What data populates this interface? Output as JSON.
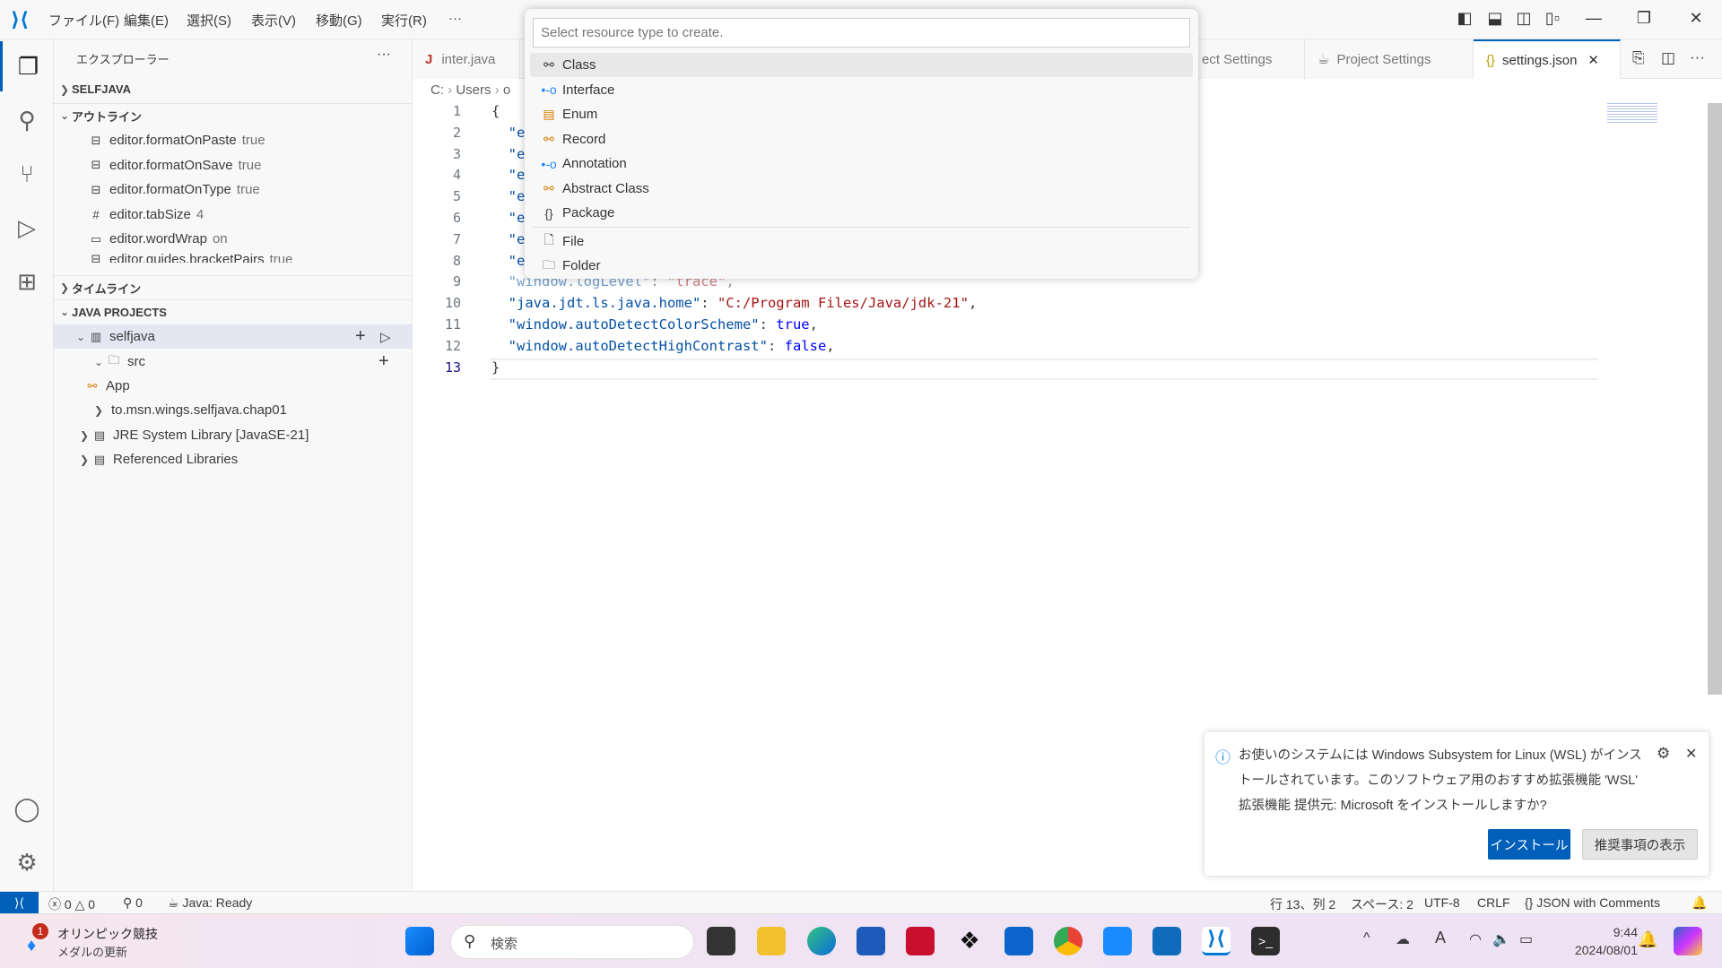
{
  "titlebar": {
    "menus": [
      "ファイル(F)",
      "編集(E)",
      "選択(S)",
      "表示(V)",
      "移動(G)",
      "実行(R)",
      "···"
    ],
    "window_controls": [
      "minimize",
      "restore",
      "close"
    ]
  },
  "activity_bar": {
    "items": [
      "explorer-icon",
      "search-icon",
      "source-control-icon",
      "run-debug-icon",
      "extensions-icon"
    ],
    "bottom": [
      "account-icon",
      "gear-icon"
    ]
  },
  "sidebar": {
    "title": "エクスプローラー",
    "more": "···",
    "selfjava": "SELFJAVA",
    "outline": {
      "title": "アウトライン",
      "items": [
        {
          "label": "editor.formatOnPaste",
          "value": "true"
        },
        {
          "label": "editor.formatOnSave",
          "value": "true"
        },
        {
          "label": "editor.formatOnType",
          "value": "true"
        },
        {
          "label": "editor.tabSize",
          "value": "4"
        },
        {
          "label": "editor.wordWrap",
          "value": "on"
        },
        {
          "label": "editor.guides.bracketPairs",
          "value": "true"
        }
      ]
    },
    "timeline": "タイムライン",
    "java_projects": {
      "title": "JAVA PROJECTS",
      "items": [
        "selfjava",
        "src",
        "App",
        "to.msn.wings.selfjava.chap01",
        "JRE System Library [JavaSE-21]",
        "Referenced Libraries"
      ]
    }
  },
  "tabs": [
    {
      "label": "inter.java"
    },
    {
      "label": "ect Settings"
    },
    {
      "label": "Project Settings"
    },
    {
      "label": "settings.json",
      "active": true
    }
  ],
  "breadcrumb": [
    "C:",
    "Users",
    "o"
  ],
  "editor": {
    "line_numbers": [
      "1",
      "2",
      "3",
      "4",
      "5",
      "6",
      "7",
      "8",
      "9",
      "10",
      "11",
      "12",
      "13"
    ],
    "lines": [
      [
        {
          "t": "{",
          "c": "p"
        }
      ],
      [
        {
          "t": "  \"e",
          "c": "k"
        }
      ],
      [
        {
          "t": "  \"e",
          "c": "k"
        }
      ],
      [
        {
          "t": "  \"e",
          "c": "k"
        }
      ],
      [
        {
          "t": "  \"e",
          "c": "k"
        }
      ],
      [
        {
          "t": "  \"e",
          "c": "k"
        }
      ],
      [
        {
          "t": "  \"e",
          "c": "k"
        }
      ],
      [
        {
          "t": "  \"e",
          "c": "k"
        }
      ],
      [
        {
          "t": "  \"window.logLevel\"",
          "c": "k"
        },
        {
          "t": ": ",
          "c": "p"
        },
        {
          "t": "\"trace\"",
          "c": "s"
        },
        {
          "t": ",",
          "c": "p"
        }
      ],
      [
        {
          "t": "  \"java.jdt.ls.java.home\"",
          "c": "k"
        },
        {
          "t": ": ",
          "c": "p"
        },
        {
          "t": "\"C:/Program Files/Java/jdk-21\"",
          "c": "s"
        },
        {
          "t": ",",
          "c": "p"
        }
      ],
      [
        {
          "t": "  \"window.autoDetectColorScheme\"",
          "c": "k"
        },
        {
          "t": ": ",
          "c": "p"
        },
        {
          "t": "true",
          "c": "b"
        },
        {
          "t": ",",
          "c": "p"
        }
      ],
      [
        {
          "t": "  \"window.autoDetectHighContrast\"",
          "c": "k"
        },
        {
          "t": ": ",
          "c": "p"
        },
        {
          "t": "false",
          "c": "b"
        },
        {
          "t": ",",
          "c": "p"
        }
      ],
      [
        {
          "t": "}",
          "c": "p"
        }
      ]
    ]
  },
  "quick_pick": {
    "placeholder": "Select resource type to create.",
    "items": [
      {
        "label": "Class",
        "icon": "class-icon"
      },
      {
        "label": "Interface",
        "icon": "interface-icon"
      },
      {
        "label": "Enum",
        "icon": "enum-icon"
      },
      {
        "label": "Record",
        "icon": "record-icon"
      },
      {
        "label": "Annotation",
        "icon": "annotation-icon"
      },
      {
        "label": "Abstract Class",
        "icon": "abstract-class-icon"
      },
      {
        "label": "Package",
        "icon": "package-icon"
      },
      {
        "label": "File",
        "icon": "file-icon"
      },
      {
        "label": "Folder",
        "icon": "folder-icon"
      }
    ]
  },
  "notification": {
    "text": "お使いのシステムには Windows Subsystem for Linux (WSL) がインストールされています。このソフトウェア用のおすすめ拡張機能 'WSL' 拡張機能 提供元: Microsoft をインストールしますか?",
    "install": "インストール",
    "show": "推奨事項の表示"
  },
  "statusbar": {
    "errors": "0",
    "warnings": "0",
    "ports": "0",
    "java": "Java: Ready",
    "position": "行 13、列 2",
    "spaces": "スペース: 2",
    "encoding": "UTF-8",
    "eol": "CRLF",
    "language": "JSON with Comments"
  },
  "taskbar": {
    "news_badge": "1",
    "news_title": "オリンピック競技",
    "news_sub": "メダルの更新",
    "search": "検索",
    "time": "9:44",
    "date": "2024/08/01"
  },
  "colors": {
    "accent": "#005fb8",
    "key": "#0451a5",
    "string": "#a31515",
    "keyword": "#0000ff"
  }
}
